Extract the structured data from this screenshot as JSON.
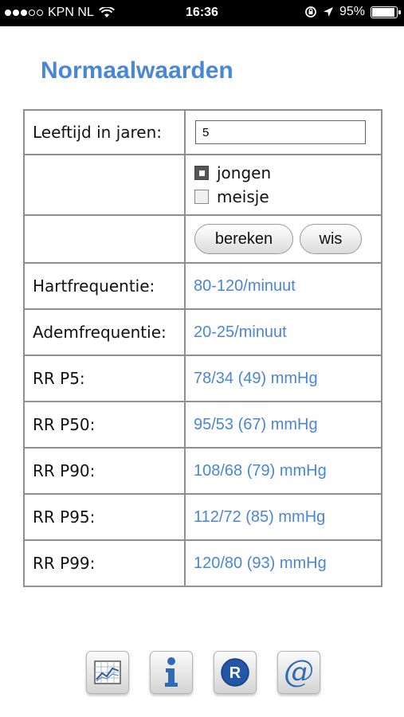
{
  "status_bar": {
    "carrier": "KPN NL",
    "time": "16:36",
    "battery_percent": "95%",
    "battery_level": 0.95,
    "icons": [
      "signal-dots-icon",
      "wifi-icon",
      "rotation-lock-icon",
      "location-arrow-icon",
      "battery-icon"
    ]
  },
  "page": {
    "title": "Normaalwaarden"
  },
  "form": {
    "age_label": "Leeftijd in jaren:",
    "age_value": "5",
    "gender_options": [
      {
        "label": "jongen",
        "checked": true
      },
      {
        "label": "meisje",
        "checked": false
      }
    ],
    "calculate_label": "bereken",
    "clear_label": "wis"
  },
  "results": [
    {
      "label": "Hartfrequentie:",
      "value": "80-120/minuut"
    },
    {
      "label": "Ademfrequentie:",
      "value": "20-25/minuut"
    },
    {
      "label": "RR P5:",
      "value": "78/34 (49) mmHg"
    },
    {
      "label": "RR P50:",
      "value": "95/53 (67) mmHg"
    },
    {
      "label": "RR P90:",
      "value": "108/68 (79) mmHg"
    },
    {
      "label": "RR P95:",
      "value": "112/72 (85) mmHg"
    },
    {
      "label": "RR P99:",
      "value": "120/80 (93) mmHg"
    }
  ],
  "toolbar": {
    "buttons": [
      "chart-icon",
      "info-icon",
      "registered-icon",
      "at-sign-icon"
    ]
  },
  "colors": {
    "accent": "#4a86d8",
    "border": "#8f8f8f",
    "status_bar": "#000000"
  }
}
